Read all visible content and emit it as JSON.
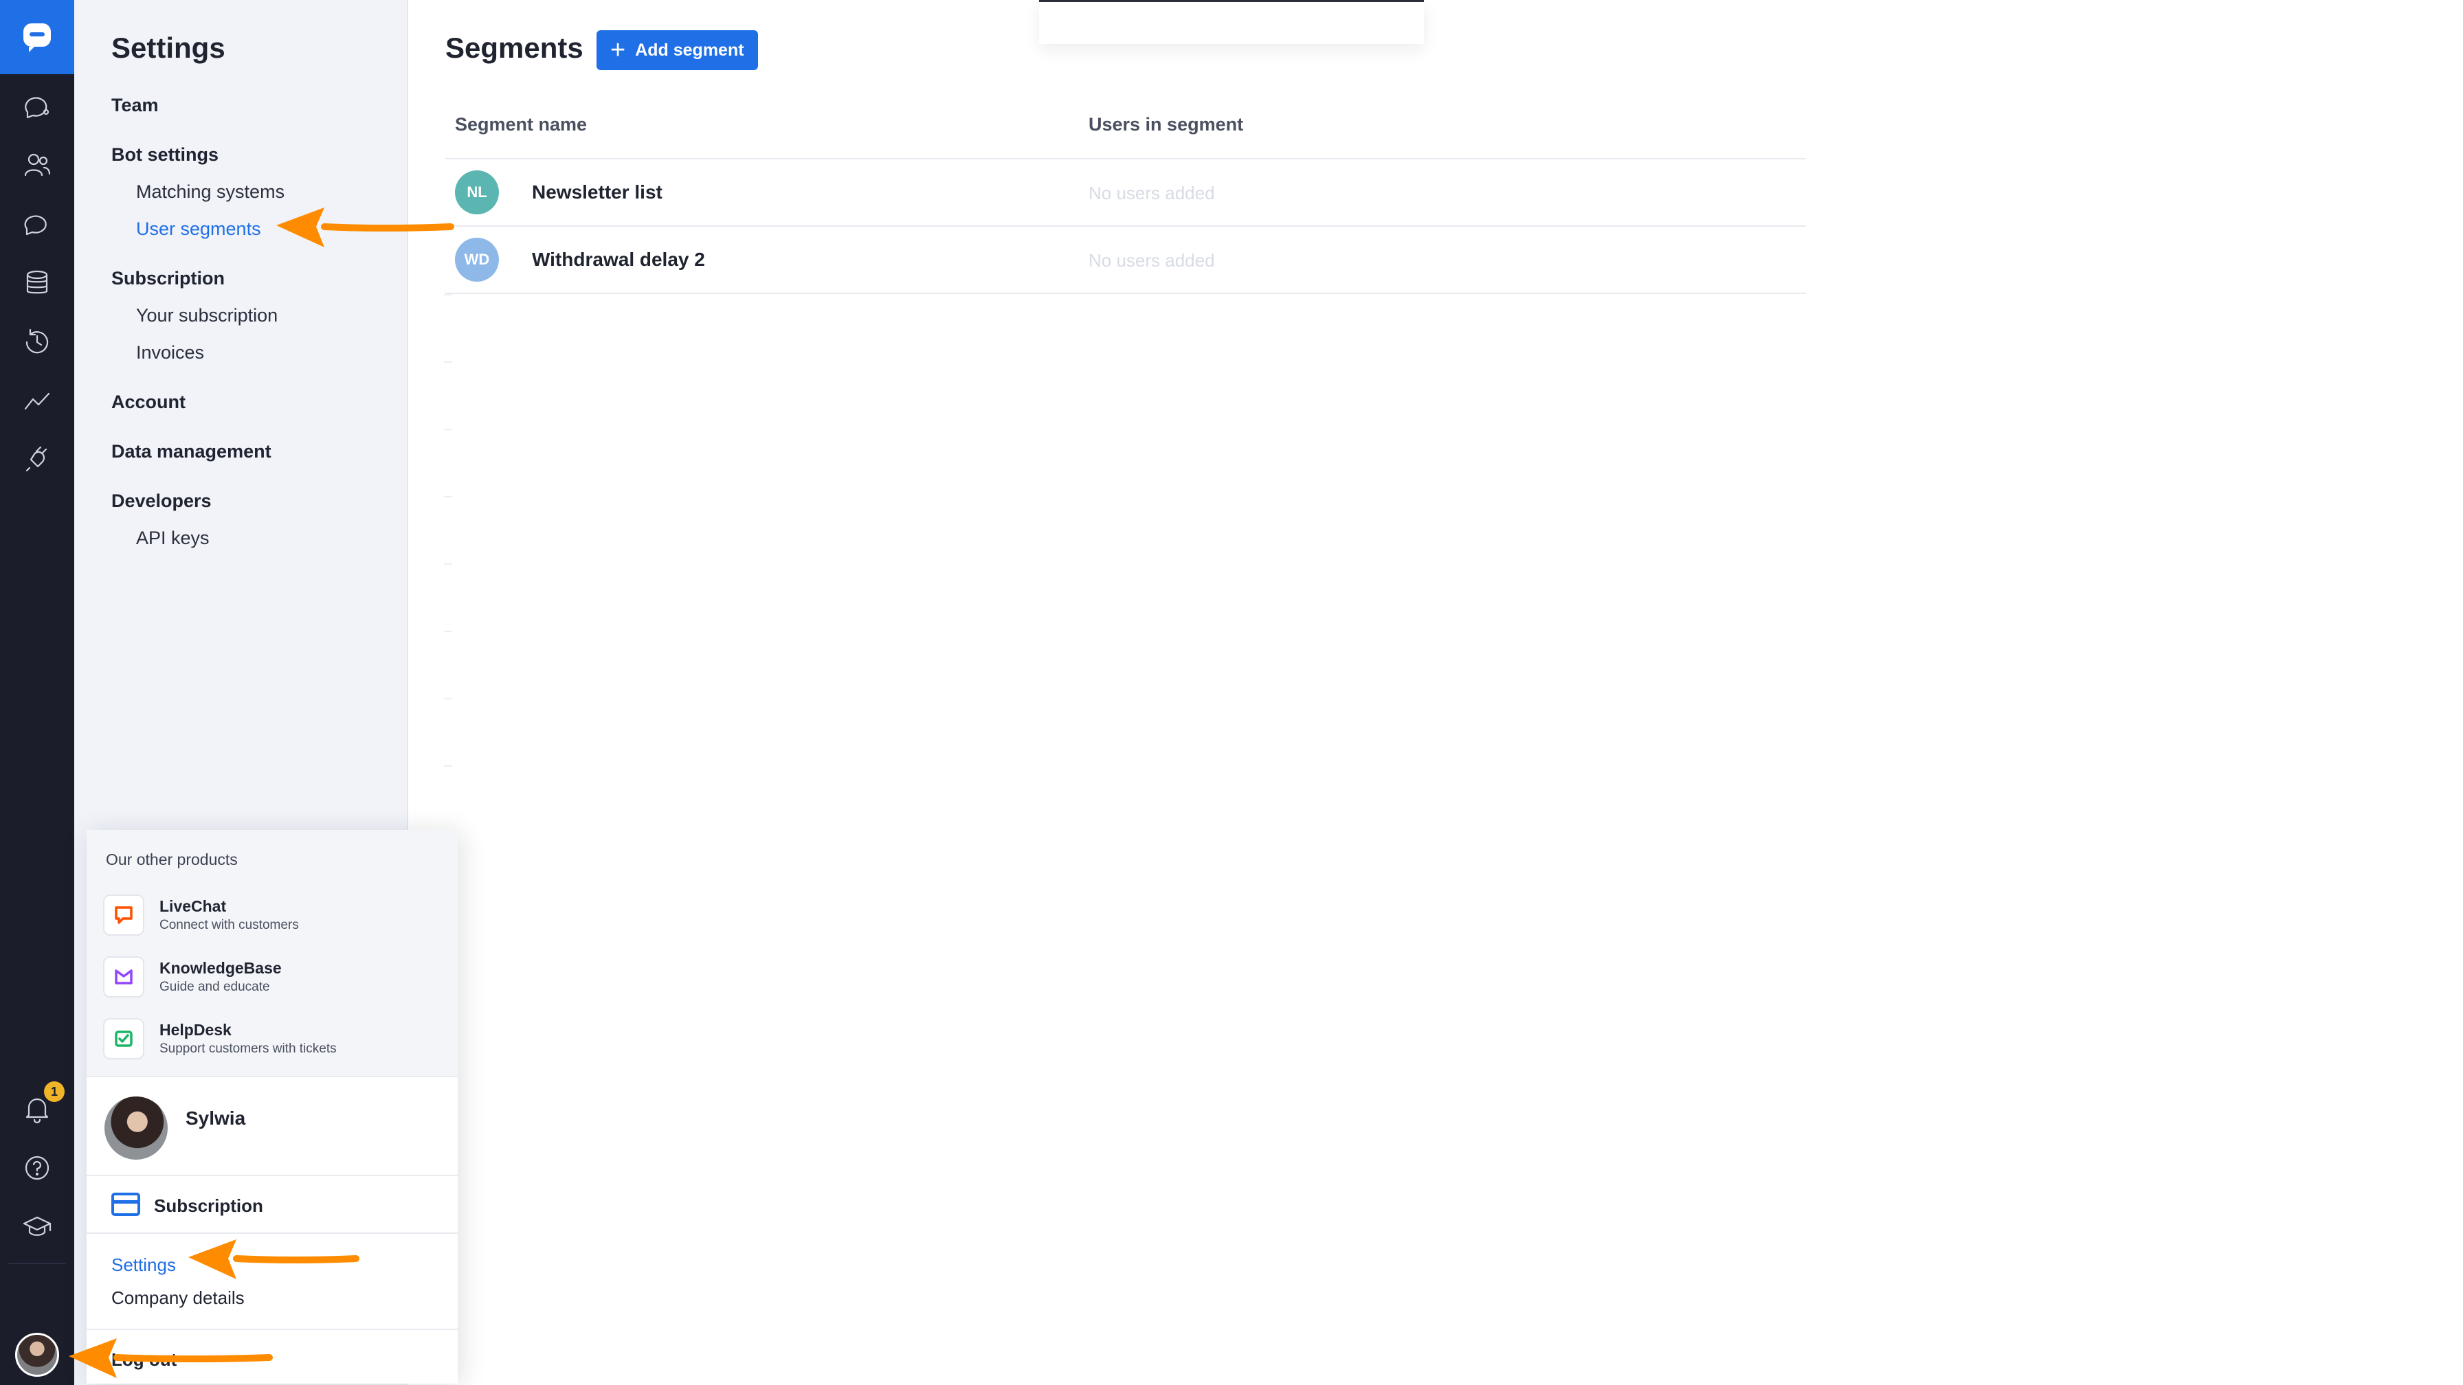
{
  "sidebar": {
    "title": "Settings",
    "sections": [
      {
        "label": "Team",
        "items": []
      },
      {
        "label": "Bot settings",
        "items": [
          "Matching systems",
          "User segments"
        ]
      },
      {
        "label": "Subscription",
        "items": [
          "Your subscription",
          "Invoices"
        ]
      },
      {
        "label": "Account",
        "items": []
      },
      {
        "label": "Data management",
        "items": []
      },
      {
        "label": "Developers",
        "items": [
          "API keys"
        ]
      }
    ],
    "active_item": "User segments"
  },
  "rail": {
    "notification_count": "1",
    "icons": [
      "chatbot-logo-icon",
      "chats-icon",
      "users-icon",
      "stories-icon",
      "database-icon",
      "history-icon",
      "analytics-icon",
      "integrations-icon",
      "bell-icon",
      "help-icon",
      "academy-icon"
    ]
  },
  "main": {
    "title": "Segments",
    "add_button": "Add segment",
    "columns": [
      "Segment name",
      "Users in segment"
    ],
    "rows": [
      {
        "initials": "NL",
        "name": "Newsletter list",
        "users": "No users added",
        "avatar_color": "#5bb6b1"
      },
      {
        "initials": "WD",
        "name": "Withdrawal delay 2",
        "users": "No users added",
        "avatar_color": "#8db8e8"
      }
    ]
  },
  "popup": {
    "products_heading": "Our other products",
    "products": [
      {
        "name": "LiveChat",
        "desc": "Connect with customers",
        "icon": "livechat-icon",
        "color": "#ff5100"
      },
      {
        "name": "KnowledgeBase",
        "desc": "Guide and educate",
        "icon": "knowledgebase-icon",
        "color": "#9146ff"
      },
      {
        "name": "HelpDesk",
        "desc": "Support customers with tickets",
        "icon": "helpdesk-icon",
        "color": "#1bb566"
      }
    ],
    "user_name": "Sylwia",
    "subscription": "Subscription",
    "settings": "Settings",
    "company_details": "Company details",
    "logout": "Log out"
  },
  "colors": {
    "accent": "#1f6fe6",
    "rail": "#1b1d2b",
    "sidebar": "#f1f3f9",
    "annotation_arrow": "#ff8c00"
  }
}
